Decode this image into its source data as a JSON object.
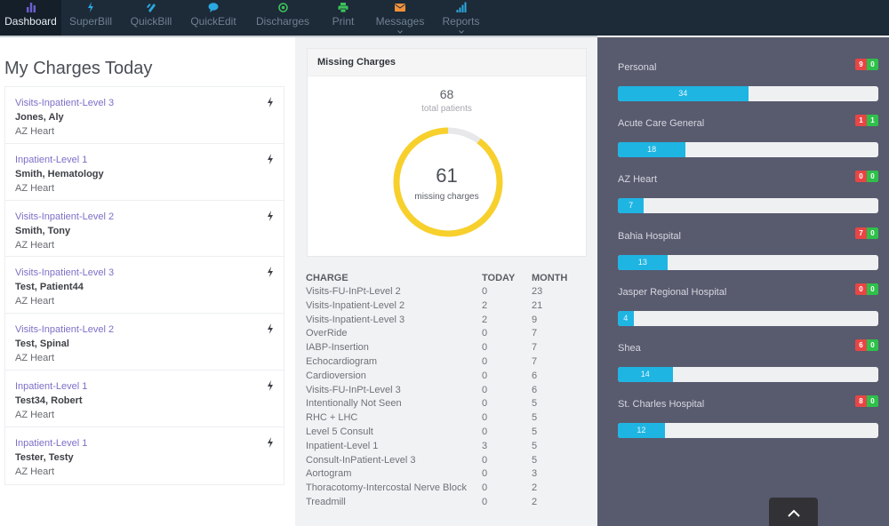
{
  "nav": {
    "items": [
      {
        "label": "Dashboard",
        "icon": "bar-chart-icon",
        "active": true,
        "dropdown": false
      },
      {
        "label": "SuperBill",
        "icon": "bolt-icon",
        "active": false,
        "dropdown": false
      },
      {
        "label": "QuickBill",
        "icon": "bill-icon",
        "active": false,
        "dropdown": false
      },
      {
        "label": "QuickEdit",
        "icon": "chat-bubble-icon",
        "active": false,
        "dropdown": false
      },
      {
        "label": "Discharges",
        "icon": "target-icon",
        "active": false,
        "dropdown": false
      },
      {
        "label": "Print",
        "icon": "printer-icon",
        "active": false,
        "dropdown": false
      },
      {
        "label": "Messages",
        "icon": "envelope-icon",
        "active": false,
        "dropdown": true
      },
      {
        "label": "Reports",
        "icon": "signal-bars-icon",
        "active": false,
        "dropdown": true
      }
    ],
    "colors": {
      "dashboard": "#6c5fd0",
      "superbill": "#2aa9e0",
      "quickbill": "#2aa9e0",
      "quickedit": "#2aa9e0",
      "discharges": "#3cc35a",
      "print": "#3cc35a",
      "messages": "#f0923a",
      "reports": "#2aa9e0"
    }
  },
  "my_charges": {
    "title": "My Charges Today",
    "items": [
      {
        "charge": "Visits-Inpatient-Level 3",
        "patient": "Jones, Aly",
        "location": "AZ Heart"
      },
      {
        "charge": "Inpatient-Level 1",
        "patient": "Smith, Hematology",
        "location": "AZ Heart"
      },
      {
        "charge": "Visits-Inpatient-Level 2",
        "patient": "Smith, Tony",
        "location": "AZ Heart"
      },
      {
        "charge": "Visits-Inpatient-Level 3",
        "patient": "Test, Patient44",
        "location": "AZ Heart"
      },
      {
        "charge": "Visits-Inpatient-Level 2",
        "patient": "Test, Spinal",
        "location": "AZ Heart"
      },
      {
        "charge": "Inpatient-Level 1",
        "patient": "Test34, Robert",
        "location": "AZ Heart"
      },
      {
        "charge": "Inpatient-Level 1",
        "patient": "Tester, Testy",
        "location": "AZ Heart"
      }
    ]
  },
  "missing_charges": {
    "title": "Missing Charges",
    "total_patients": "68",
    "total_patients_label": "total patients",
    "missing": "61",
    "missing_label": "missing charges",
    "missing_fraction": 0.897,
    "ring_color": "#f7d02c",
    "ring_bg_color": "#e6e8ea"
  },
  "charge_table": {
    "headers": [
      "CHARGE",
      "TODAY",
      "MONTH"
    ],
    "rows": [
      [
        "Visits-FU-InPt-Level 2",
        "0",
        "23"
      ],
      [
        "Visits-Inpatient-Level 2",
        "2",
        "21"
      ],
      [
        "Visits-Inpatient-Level 3",
        "2",
        "9"
      ],
      [
        "OverRide",
        "0",
        "7"
      ],
      [
        "IABP-Insertion",
        "0",
        "7"
      ],
      [
        "Echocardiogram",
        "0",
        "7"
      ],
      [
        "Cardioversion",
        "0",
        "6"
      ],
      [
        "Visits-FU-InPt-Level 3",
        "0",
        "6"
      ],
      [
        "Intentionally Not Seen",
        "0",
        "5"
      ],
      [
        "RHC + LHC",
        "0",
        "5"
      ],
      [
        "Level 5 Consult",
        "0",
        "5"
      ],
      [
        "Inpatient-Level 1",
        "3",
        "5"
      ],
      [
        "Consult-InPatient-Level 3",
        "0",
        "5"
      ],
      [
        "Aortogram",
        "0",
        "3"
      ],
      [
        "Thoracotomy-Intercostal Nerve Block",
        "0",
        "2"
      ],
      [
        "Treadmill",
        "0",
        "2"
      ]
    ]
  },
  "sites": {
    "max_value": 68,
    "items": [
      {
        "name": "Personal",
        "value": "34",
        "red": "9",
        "green": "0",
        "fraction": 0.5
      },
      {
        "name": "Acute Care General",
        "value": "18",
        "red": "1",
        "green": "1",
        "fraction": 0.26
      },
      {
        "name": "AZ Heart",
        "value": "7",
        "red": "0",
        "green": "0",
        "fraction": 0.1
      },
      {
        "name": "Bahia Hospital",
        "value": "13",
        "red": "7",
        "green": "0",
        "fraction": 0.19
      },
      {
        "name": "Jasper Regional Hospital",
        "value": "4",
        "red": "0",
        "green": "0",
        "fraction": 0.06
      },
      {
        "name": "Shea",
        "value": "14",
        "red": "6",
        "green": "0",
        "fraction": 0.21
      },
      {
        "name": "St. Charles Hospital",
        "value": "12",
        "red": "8",
        "green": "0",
        "fraction": 0.18
      }
    ]
  },
  "scroll_top": {
    "icon": "chevron-up-icon"
  }
}
